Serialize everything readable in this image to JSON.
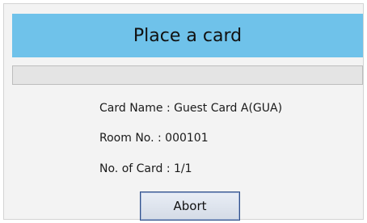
{
  "dialog": {
    "title": "Place a card",
    "progress": 0,
    "card_name": "Card Name : Guest Card A(GUA)",
    "room_no": "Room No. : 000101",
    "no_of_card": "No. of Card : 1/1",
    "abort_label": "Abort"
  },
  "colors": {
    "header": "#6fc2ea",
    "background": "#f3f3f3",
    "progress_track": "#e4e4e4",
    "button_border": "#2f4f8a"
  }
}
